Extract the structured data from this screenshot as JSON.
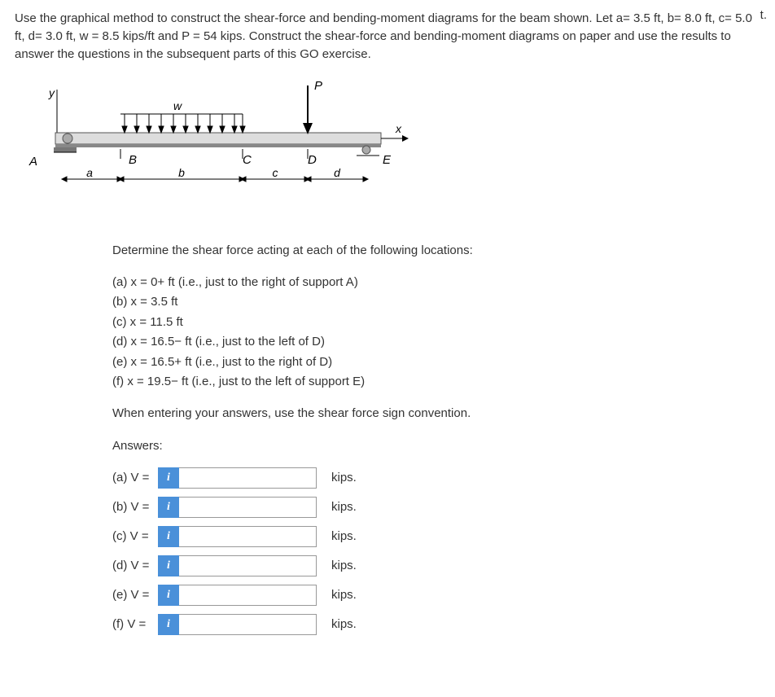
{
  "problem": {
    "intro": "Use the graphical method to construct the shear-force and bending-moment diagrams for the beam shown. Let a= 3.5 ft, b= 8.0 ft, c= 5.0 ft, d= 3.0 ft, w =  8.5 kips/ft and P =  54 kips. Construct the shear-force and bending-moment diagrams on paper and use the results to answer the questions in the subsequent parts of this GO exercise.",
    "top_right": "t."
  },
  "diagram": {
    "labels": {
      "P": "P",
      "w": "w",
      "x": "x",
      "y": "y",
      "A": "A",
      "B": "B",
      "C": "C",
      "D": "D",
      "E": "E",
      "a": "a",
      "b": "b",
      "c": "c",
      "d": "d"
    }
  },
  "question": {
    "prompt": "Determine the shear force acting at each of the following locations:",
    "items": [
      "(a) x = 0+ ft (i.e., just to the right of support A)",
      "(b) x = 3.5 ft",
      "(c) x = 11.5 ft",
      "(d) x = 16.5− ft (i.e., just to the left of D)",
      "(e) x = 16.5+ ft (i.e., just to the right of D)",
      "(f) x = 19.5− ft (i.e., just to the left of support E)"
    ],
    "note": "When entering your answers, use the shear force sign convention.",
    "answers_header": "Answers:"
  },
  "answers": [
    {
      "label": "(a) V =",
      "unit": "kips.",
      "value": ""
    },
    {
      "label": "(b) V =",
      "unit": "kips.",
      "value": ""
    },
    {
      "label": "(c) V =",
      "unit": "kips.",
      "value": ""
    },
    {
      "label": "(d) V =",
      "unit": "kips.",
      "value": ""
    },
    {
      "label": "(e) V =",
      "unit": "kips.",
      "value": ""
    },
    {
      "label": "(f) V =",
      "unit": "kips.",
      "value": ""
    }
  ],
  "info_glyph": "i"
}
